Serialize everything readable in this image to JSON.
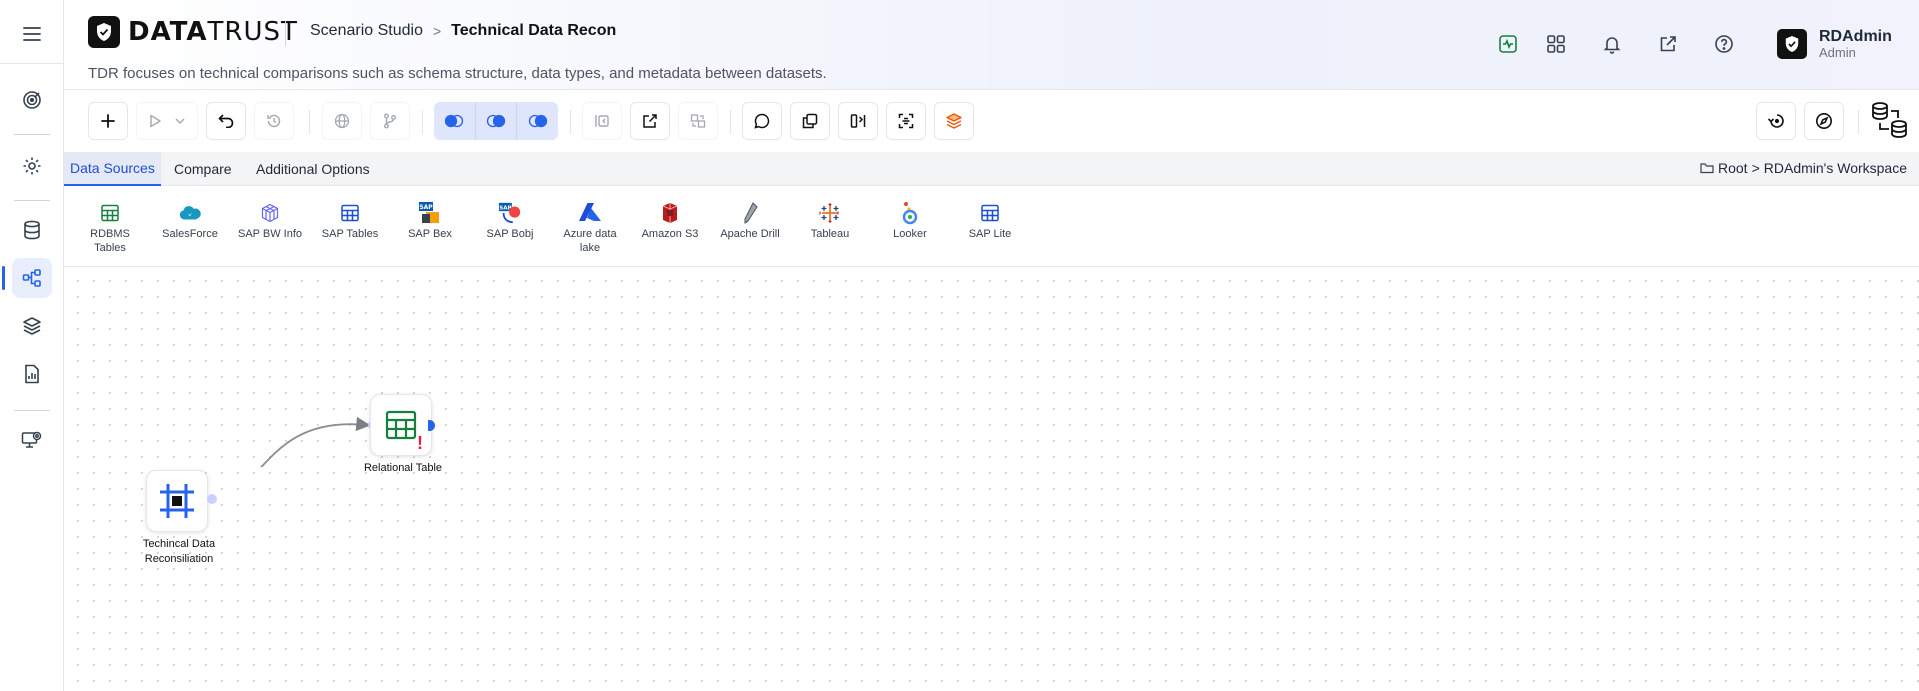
{
  "brand": {
    "name_bold": "DATA",
    "name_regular": "TRUST"
  },
  "breadcrumb": {
    "section": "Scenario Studio",
    "separator": ">",
    "current": "Technical Data Recon"
  },
  "subtitle": "TDR focuses on technical comparisons such as schema structure, data types, and metadata between datasets.",
  "user": {
    "name": "RDAdmin",
    "role": "Admin"
  },
  "tabs": [
    {
      "label": "Data Sources",
      "active": true
    },
    {
      "label": "Compare",
      "active": false
    },
    {
      "label": "Additional Options",
      "active": false
    }
  ],
  "workspace": {
    "root": "Root",
    "separator": ">",
    "name": "RDAdmin's Workspace"
  },
  "palette": [
    {
      "label": "RDBMS Tables",
      "icon": "table-icon"
    },
    {
      "label": "SalesForce",
      "icon": "salesforce-icon"
    },
    {
      "label": "SAP BW Info",
      "icon": "cube-icon"
    },
    {
      "label": "SAP Tables",
      "icon": "table-icon"
    },
    {
      "label": "SAP Bex",
      "icon": "sap-bex-icon"
    },
    {
      "label": "SAP Bobj",
      "icon": "sap-bobj-icon"
    },
    {
      "label": "Azure data lake",
      "icon": "azure-icon"
    },
    {
      "label": "Amazon S3",
      "icon": "s3-icon"
    },
    {
      "label": "Apache Drill",
      "icon": "drill-icon"
    },
    {
      "label": "Tableau",
      "icon": "tableau-icon"
    },
    {
      "label": "Looker",
      "icon": "looker-icon"
    },
    {
      "label": "SAP Lite",
      "icon": "table-icon"
    }
  ],
  "nodes": {
    "source": {
      "label": "Techincal Data Reconsiliation"
    },
    "target": {
      "label": "Relational Table",
      "warning": "!"
    }
  },
  "colors": {
    "accent": "#2563eb",
    "table_green": "#15803d",
    "warning": "#e11d48"
  }
}
